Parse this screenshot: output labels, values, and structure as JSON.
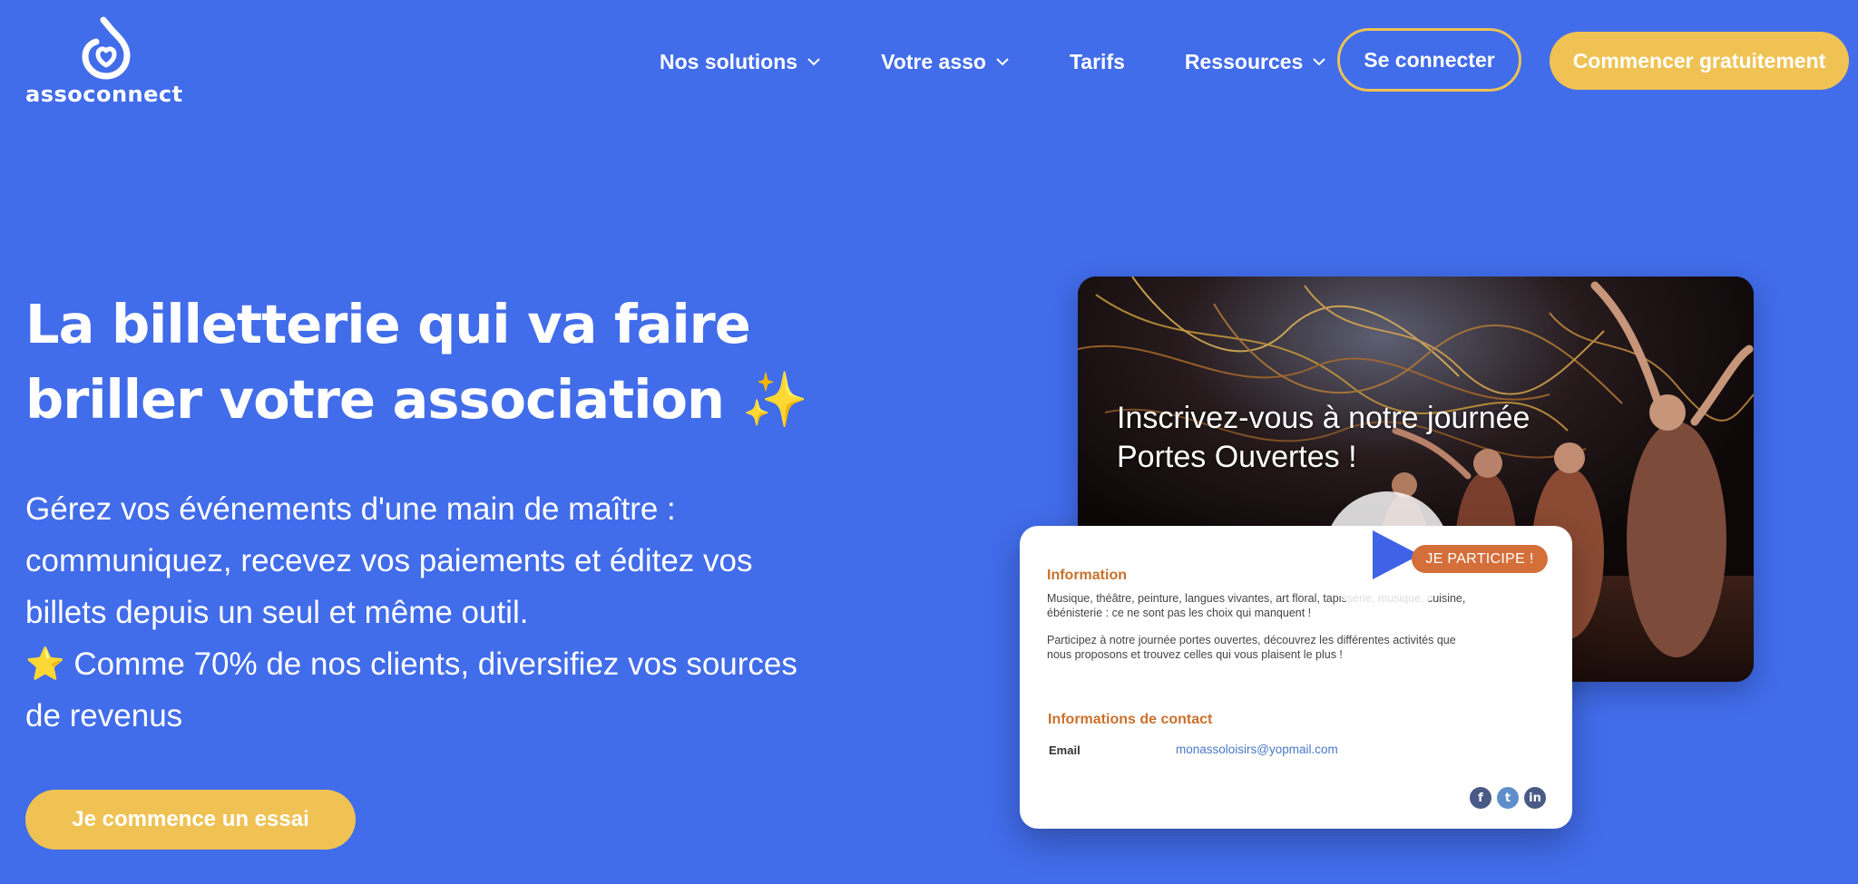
{
  "brand": {
    "name": "assoconnect"
  },
  "nav": {
    "items": [
      {
        "label": "Nos solutions",
        "has_dropdown": true
      },
      {
        "label": "Votre asso",
        "has_dropdown": true
      },
      {
        "label": "Tarifs",
        "has_dropdown": false
      },
      {
        "label": "Ressources",
        "has_dropdown": true
      }
    ],
    "login_label": "Se connecter",
    "cta_label": "Commencer gratuitement"
  },
  "hero": {
    "title_line1": "La billetterie qui va faire",
    "title_line2": "briller votre association",
    "title_emoji": "✨",
    "description_lines": [
      "Gérez vos événements d'une main de maître :",
      "communiquez, recevez vos paiements et éditez vos",
      "billets depuis un seul et même outil."
    ],
    "highlight_emoji": "⭐",
    "highlight_line1": "Comme 70% de nos clients, diversifiez vos sources",
    "highlight_line2": "de revenus",
    "trial_button": "Je commence un essai"
  },
  "mockup": {
    "photo_title_line1": "Inscrivez-vous à notre journée",
    "photo_title_line2": "Portes Ouvertes !",
    "badge_label": "JE PARTICIPE !",
    "card": {
      "info_heading": "Information",
      "info_para1_line1": "Musique, théâtre, peinture, langues vivantes, art floral, tapisserie, musique, cuisine,",
      "info_para1_line2": "ébénisterie : ce ne sont pas les choix qui manquent !",
      "info_para2_line1": "Participez à notre journée portes ouvertes, découvrez les différentes activités que",
      "info_para2_line2": "nous proposons et trouvez celles qui vous plaisent le plus !",
      "contact_heading": "Informations de contact",
      "email_label": "Email",
      "email_value": "monassoloisirs@yopmail.com",
      "socials": [
        "f",
        "t",
        "in"
      ]
    }
  },
  "colors": {
    "background": "#416cea",
    "accent_yellow": "#efc253",
    "badge_orange": "#d46f3a",
    "card_heading": "#c9712d",
    "link_blue": "#4a78c7"
  }
}
